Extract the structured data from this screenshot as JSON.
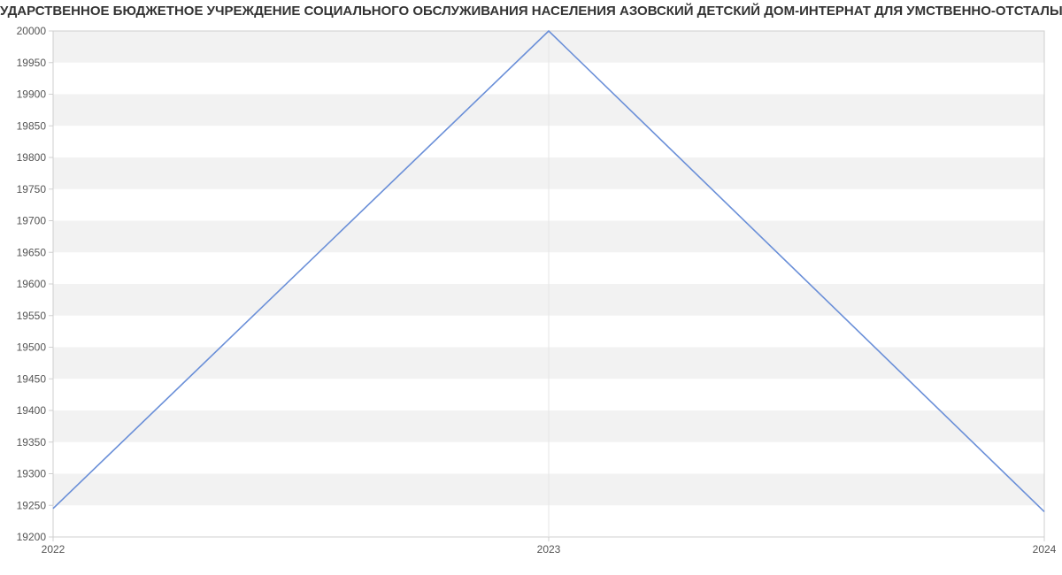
{
  "title": "УДАРСТВЕННОЕ БЮДЖЕТНОЕ УЧРЕЖДЕНИЕ СОЦИАЛЬНОГО ОБСЛУЖИВАНИЯ НАСЕЛЕНИЯ АЗОВСКИЙ ДЕТСКИЙ ДОМ-ИНТЕРНАТ ДЛЯ УМСТВЕННО-ОТСТАЛЫХ ДЕТЕЙ | Дан",
  "chart_data": {
    "type": "line",
    "x": [
      2022,
      2023,
      2024
    ],
    "values": [
      19245,
      20000,
      19240
    ],
    "xlabel": "",
    "ylabel": "",
    "ylim": [
      19200,
      20000
    ],
    "xlim": [
      2022,
      2024
    ],
    "yticks": [
      19200,
      19250,
      19300,
      19350,
      19400,
      19450,
      19500,
      19550,
      19600,
      19650,
      19700,
      19750,
      19800,
      19850,
      19900,
      19950,
      20000
    ],
    "xticks": [
      2022,
      2023,
      2024
    ],
    "line_color": "#6a8fd8"
  }
}
